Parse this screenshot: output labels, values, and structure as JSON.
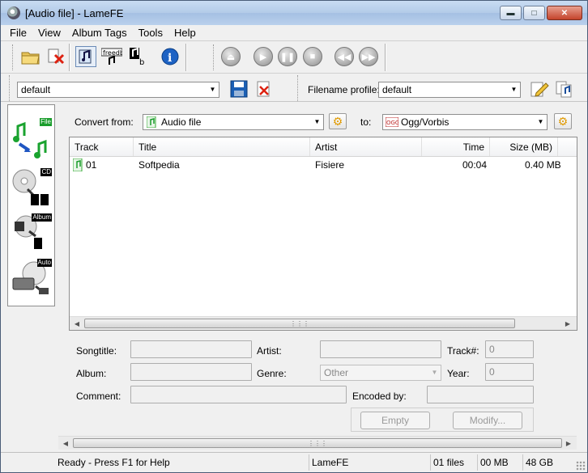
{
  "window": {
    "title": "[Audio file] - LameFE"
  },
  "menu": [
    "File",
    "View",
    "Album Tags",
    "Tools",
    "Help"
  ],
  "toolbar2": {
    "profile_value": "default",
    "filename_profile_label": "Filename profile:",
    "filename_profile_value": "default"
  },
  "leftpanel": [
    {
      "label": "File"
    },
    {
      "label": "CD"
    },
    {
      "label": "Album"
    },
    {
      "label": "Auto"
    }
  ],
  "convert": {
    "from_label": "Convert from:",
    "from_value": "Audio file",
    "to_label": "to:",
    "to_value": "Ogg/Vorbis"
  },
  "list": {
    "columns": [
      "Track",
      "Title",
      "Artist",
      "Time",
      "Size (MB)"
    ],
    "rows": [
      {
        "track": "01",
        "title": "Softpedia",
        "artist": "Fisiere",
        "time": "00:04",
        "size": "0.40 MB"
      }
    ]
  },
  "tags": {
    "songtitle_label": "Songtitle:",
    "artist_label": "Artist:",
    "track_label": "Track#:",
    "track_value": "0",
    "album_label": "Album:",
    "genre_label": "Genre:",
    "genre_value": "Other",
    "year_label": "Year:",
    "year_value": "0",
    "comment_label": "Comment:",
    "encodedby_label": "Encoded by:",
    "empty_button": "Empty",
    "modify_button": "Modify..."
  },
  "status": {
    "message": "Ready - Press F1 for Help",
    "app": "LameFE",
    "files": "01 files",
    "size": "00 MB",
    "free": "48 GB"
  }
}
